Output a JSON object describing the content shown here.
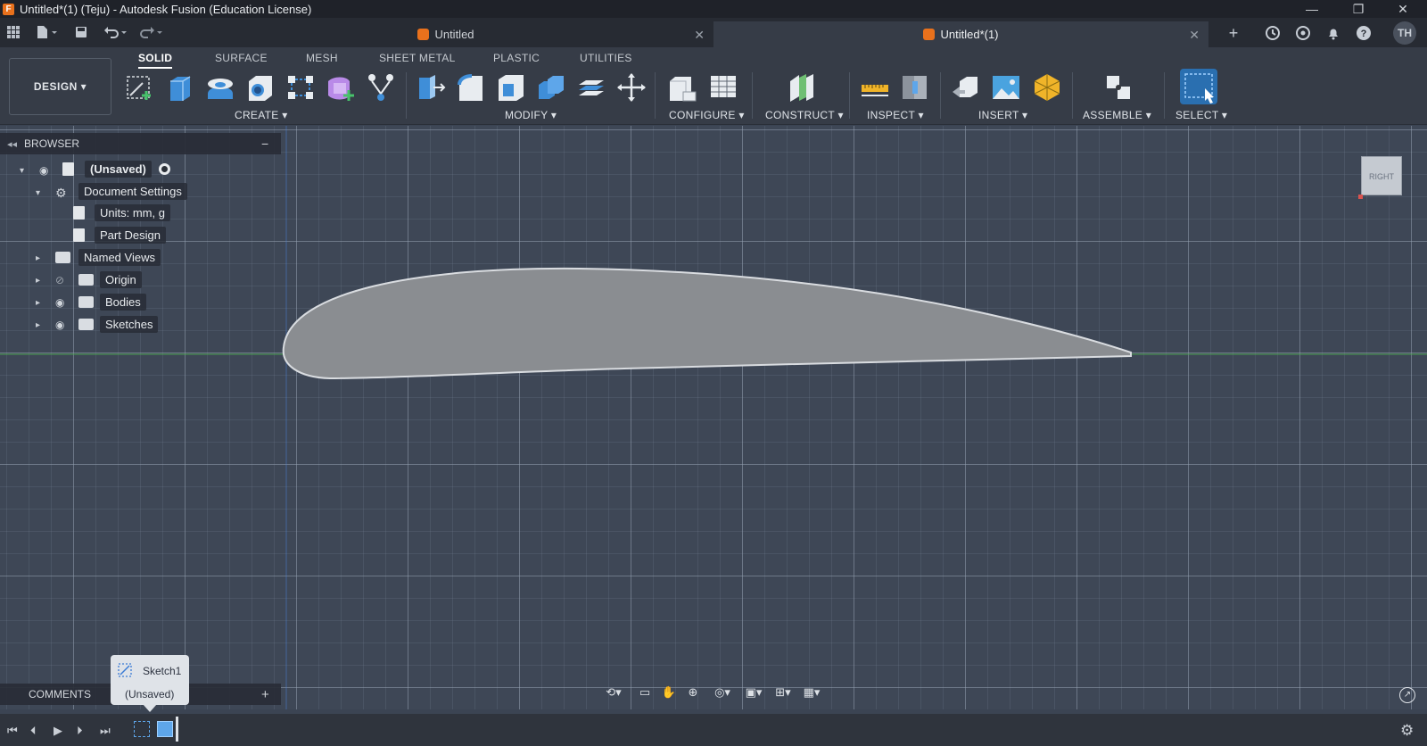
{
  "window": {
    "title": "Untitled*(1) (Teju) - Autodesk Fusion (Education License)",
    "minimize": "—",
    "restore": "❐",
    "close": "✕"
  },
  "tabs": [
    {
      "label": "Untitled"
    },
    {
      "label": "Untitled*(1)"
    }
  ],
  "user_initials": "TH",
  "design_label": "DESIGN ▾",
  "workspace_tabs": [
    "SOLID",
    "SURFACE",
    "MESH",
    "SHEET METAL",
    "PLASTIC",
    "UTILITIES"
  ],
  "tool_groups": [
    "CREATE ▾",
    "MODIFY ▾",
    "CONFIGURE ▾",
    "CONSTRUCT ▾",
    "INSPECT ▾",
    "INSERT ▾",
    "ASSEMBLE ▾",
    "SELECT ▾"
  ],
  "browser": {
    "title": "BROWSER",
    "items": [
      {
        "label": "(Unsaved)"
      },
      {
        "label": "Document Settings"
      },
      {
        "label": "Units: mm, g"
      },
      {
        "label": "Part Design"
      },
      {
        "label": "Named Views"
      },
      {
        "label": "Origin"
      },
      {
        "label": "Bodies"
      },
      {
        "label": "Sketches"
      }
    ]
  },
  "comments": {
    "label": "COMMENTS",
    "add": "+"
  },
  "sketch_tip": {
    "name": "Sketch1",
    "status": "(Unsaved)"
  },
  "viewcube_label": "RIGHT",
  "colors": {
    "accent": "#e9711c",
    "canvas": "#3e4756",
    "airfoil_fill": "#8a8d91",
    "axis_green": "#4caf50",
    "select_blue": "#3aa0ff"
  }
}
